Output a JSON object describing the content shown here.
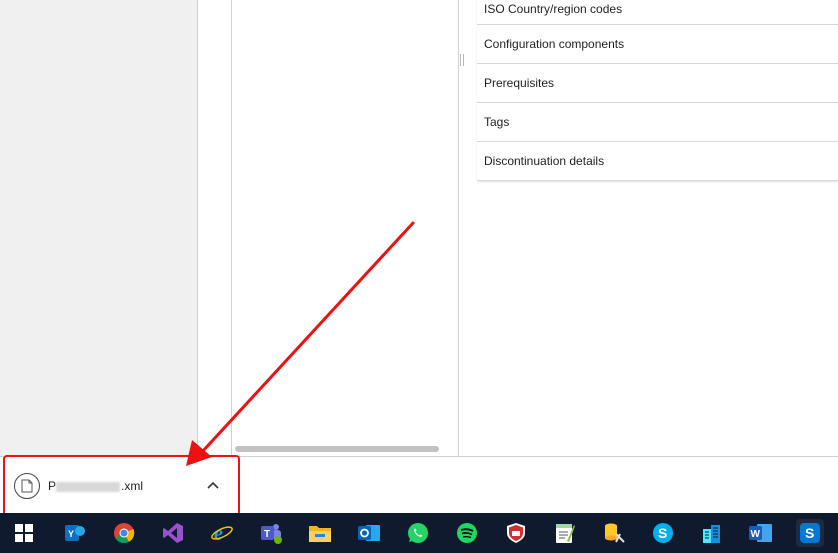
{
  "sections": [
    {
      "label": "ISO Country/region codes"
    },
    {
      "label": "Configuration components"
    },
    {
      "label": "Prerequisites"
    },
    {
      "label": "Tags"
    },
    {
      "label": "Discontinuation details"
    }
  ],
  "download": {
    "file_name_visible": "xml",
    "file_name_prefix": "P"
  },
  "colors": {
    "annotation": "#ee1111",
    "taskbar": "#0f1a2e"
  },
  "taskbar_icons": [
    "windows-start-icon",
    "yammer-icon",
    "chrome-icon",
    "visual-studio-icon",
    "internet-explorer-icon",
    "teams-icon",
    "file-explorer-icon",
    "outlook-icon",
    "whatsapp-icon",
    "spotify-icon",
    "security-app-icon",
    "notepad-plus-icon",
    "database-tool-icon",
    "skype-icon",
    "azure-data-icon",
    "word-icon",
    "skype-business-icon"
  ]
}
